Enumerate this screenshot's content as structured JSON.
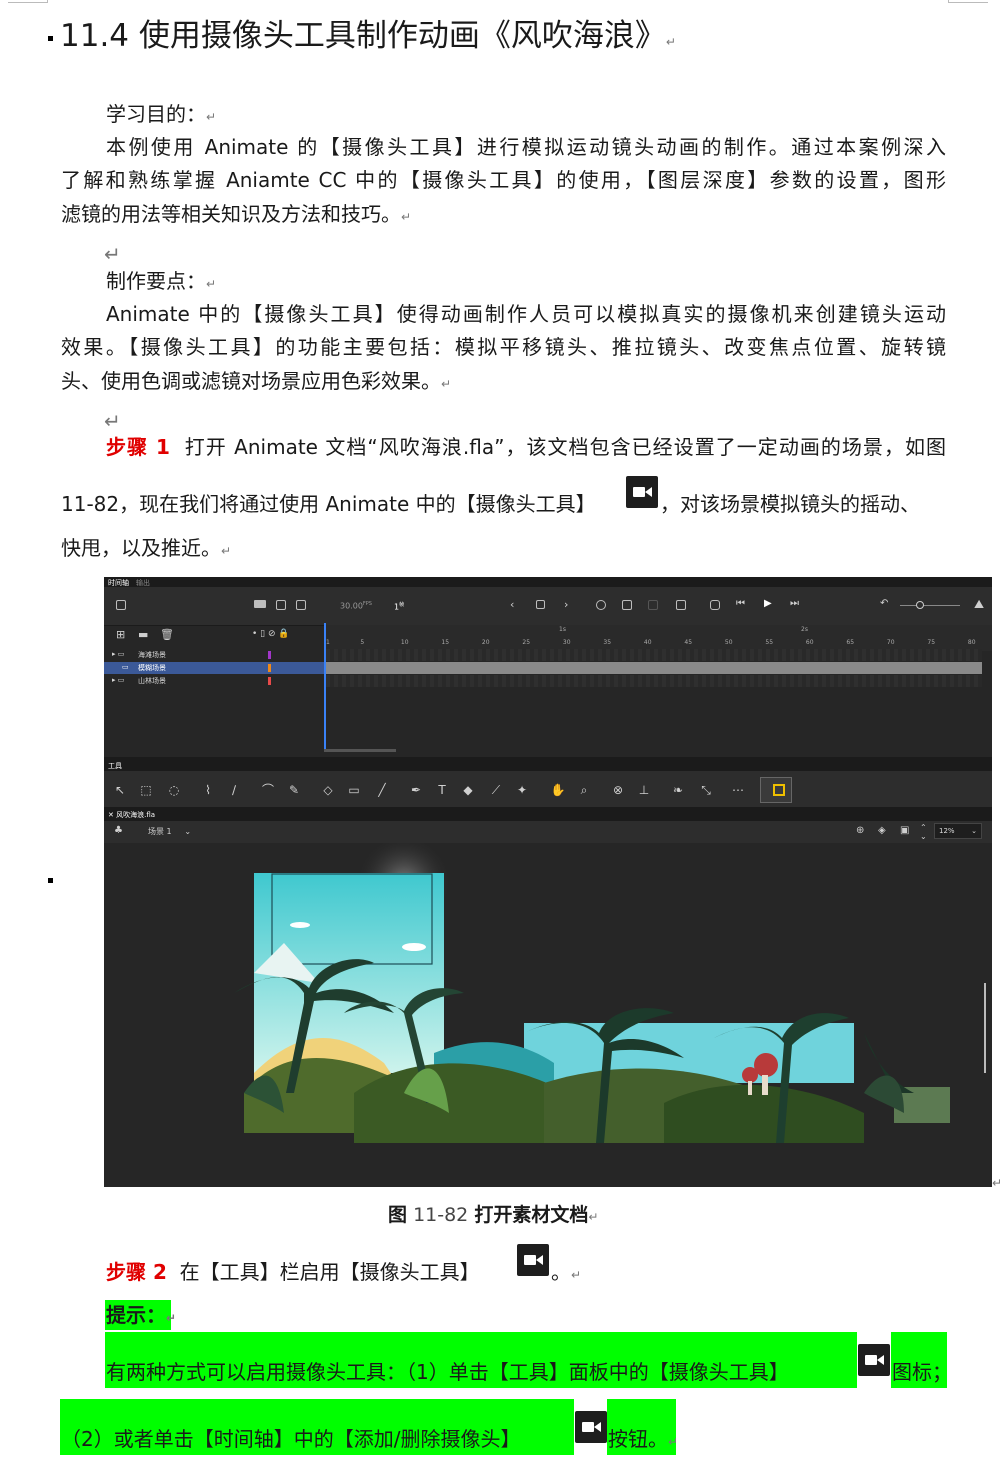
{
  "heading": "11.4 使用摄像头工具制作动画《风吹海浪》",
  "objective_label": "学习目的：",
  "objective_lines": [
    "本例使用 Animate 的【摄像头工具】进行模拟运动镜头动画的制作。通过本案例深入",
    "了解和熟练掌握 Aniamte CC 中的【摄像头工具】的使用，【图层深度】参数的设置，图形",
    "滤镜的用法等相关知识及方法和技巧。"
  ],
  "points_label": "制作要点：",
  "points_lines": [
    "Animate 中的【摄像头工具】使得动画制作人员可以模拟真实的摄像机来创建镜头运动",
    "效果。【摄像头工具】的功能主要包括：模拟平移镜头、推拉镜头、改变焦点位置、旋转镜",
    "头、使用色调或滤镜对场景应用色彩效果。"
  ],
  "step1": {
    "label": "步骤 1",
    "line1": "打开 Animate 文档“风吹海浪.fla”，该文档包含已经设置了一定动画的场景，如图",
    "line2a": "11-82，现在我们将通过使用 Animate 中的【摄像头工具】",
    "line2b": "，对该场景模拟镜头的摇动、",
    "line3": "快甩，以及推近。"
  },
  "figure": {
    "tabs": [
      "时间轴",
      "输出"
    ],
    "fps": "30.00",
    "fps_unit": "FPS",
    "frame": "1",
    "frame_unit": "帧",
    "ruler": [
      "1",
      "5",
      "10",
      "15",
      "20",
      "25",
      "30",
      "35",
      "40",
      "45",
      "50",
      "55",
      "60",
      "65",
      "70",
      "75",
      "80"
    ],
    "seconds": [
      "1s",
      "2s"
    ],
    "layers": [
      {
        "name": "海滩场景",
        "color": "#a236c9"
      },
      {
        "name": "模糊场景",
        "color": "#f08a1a"
      },
      {
        "name": "山林场景",
        "color": "#e84a4a"
      }
    ],
    "tools_label": "工具",
    "doc_tab": "风吹海浪.fla",
    "scene": "场景 1",
    "zoom": "12%"
  },
  "caption": {
    "prefix": "图",
    "number": "11-82",
    "text": "打开素材文档"
  },
  "step2": {
    "label": "步骤 2",
    "text": "在【工具】栏启用【摄像头工具】",
    "end": "。"
  },
  "tip_label": "提示：",
  "tip_line1a": "有两种方式可以启用摄像头工具：（1）单击【工具】面板中的【摄像头工具】",
  "tip_line1b": "图标；",
  "tip_line2a": "（2）或者单击【时间轴】中的【添加/删除摄像头】",
  "tip_line2b": "按钮。",
  "para_mark": "↵",
  "colors": {
    "step_red": "#e00000",
    "highlight": "#00ff00",
    "app_bg": "#262626"
  }
}
